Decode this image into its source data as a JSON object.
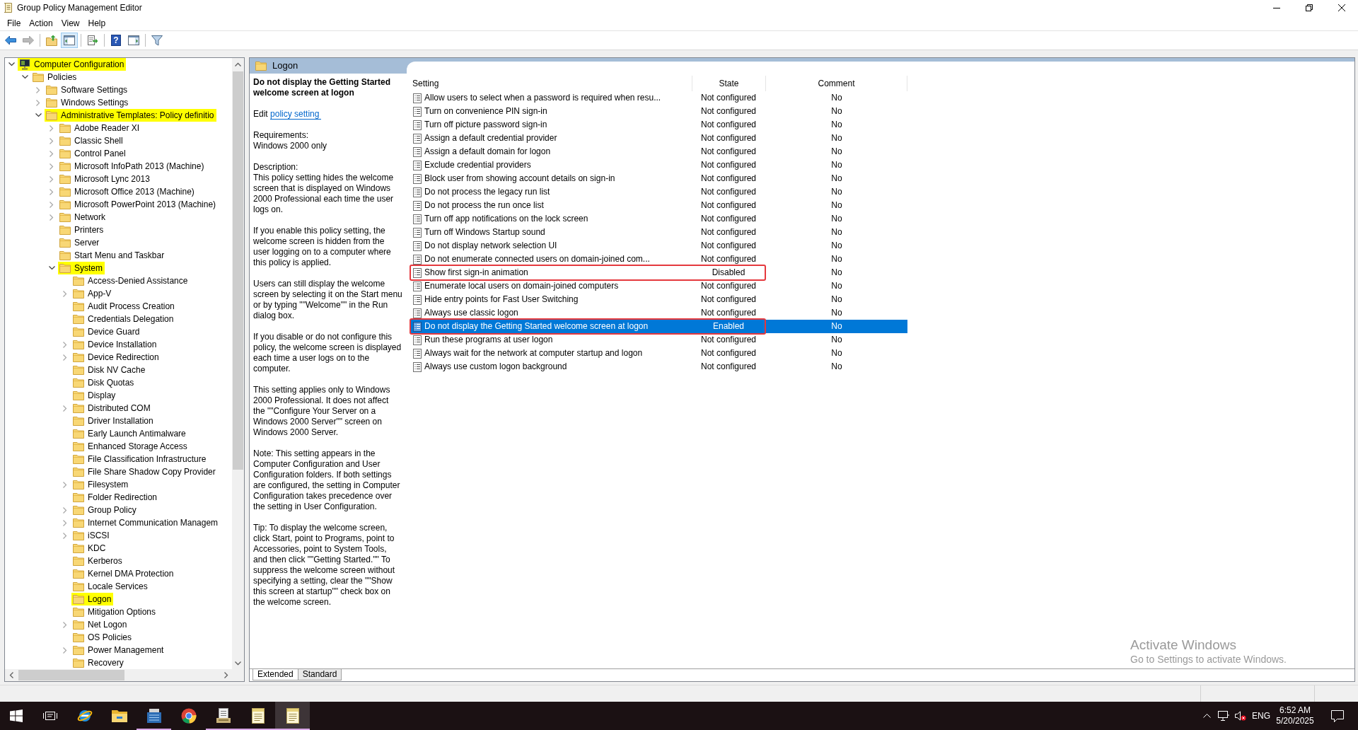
{
  "window": {
    "title": "Group Policy Management Editor"
  },
  "menu": [
    "File",
    "Action",
    "View",
    "Help"
  ],
  "toolbar": [
    {
      "kind": "back",
      "disabled": false,
      "pressed": false
    },
    {
      "kind": "forward",
      "disabled": true,
      "pressed": false
    },
    {
      "kind": "separator"
    },
    {
      "kind": "up",
      "disabled": false,
      "pressed": false
    },
    {
      "kind": "tree-pane",
      "disabled": false,
      "pressed": true
    },
    {
      "kind": "separator"
    },
    {
      "kind": "export",
      "disabled": false,
      "pressed": false
    },
    {
      "kind": "separator"
    },
    {
      "kind": "help",
      "glyph": "?",
      "disabled": false,
      "pressed": false
    },
    {
      "kind": "action-pane",
      "disabled": false,
      "pressed": false
    },
    {
      "kind": "separator"
    },
    {
      "kind": "filter",
      "disabled": false,
      "pressed": false
    }
  ],
  "tree": {
    "items": [
      {
        "label": "Computer Configuration",
        "kind": "computer",
        "expandable": true,
        "expanded": true,
        "highlighted": true,
        "children": [
          {
            "label": "Policies",
            "kind": "folder",
            "expandable": true,
            "expanded": true,
            "highlighted": false,
            "children": [
              {
                "label": "Software Settings",
                "kind": "folder",
                "expandable": true,
                "expanded": false,
                "highlighted": false
              },
              {
                "label": "Windows Settings",
                "kind": "folder",
                "expandable": true,
                "expanded": false,
                "highlighted": false
              },
              {
                "label": "Administrative Templates: Policy definitio",
                "kind": "folder",
                "expandable": true,
                "expanded": true,
                "highlighted": true,
                "children": [
                  {
                    "label": "Adobe Reader XI",
                    "kind": "folder",
                    "expandable": true,
                    "expanded": false,
                    "highlighted": false
                  },
                  {
                    "label": "Classic Shell",
                    "kind": "folder",
                    "expandable": true,
                    "expanded": false,
                    "highlighted": false
                  },
                  {
                    "label": "Control Panel",
                    "kind": "folder",
                    "expandable": true,
                    "expanded": false,
                    "highlighted": false
                  },
                  {
                    "label": "Microsoft InfoPath 2013 (Machine)",
                    "kind": "folder",
                    "expandable": true,
                    "expanded": false,
                    "highlighted": false
                  },
                  {
                    "label": "Microsoft Lync 2013",
                    "kind": "folder",
                    "expandable": true,
                    "expanded": false,
                    "highlighted": false
                  },
                  {
                    "label": "Microsoft Office 2013 (Machine)",
                    "kind": "folder",
                    "expandable": true,
                    "expanded": false,
                    "highlighted": false
                  },
                  {
                    "label": "Microsoft PowerPoint 2013 (Machine)",
                    "kind": "folder",
                    "expandable": true,
                    "expanded": false,
                    "highlighted": false
                  },
                  {
                    "label": "Network",
                    "kind": "folder",
                    "expandable": true,
                    "expanded": false,
                    "highlighted": false
                  },
                  {
                    "label": "Printers",
                    "kind": "folder",
                    "expandable": false,
                    "highlighted": false
                  },
                  {
                    "label": "Server",
                    "kind": "folder",
                    "expandable": false,
                    "highlighted": false
                  },
                  {
                    "label": "Start Menu and Taskbar",
                    "kind": "folder",
                    "expandable": false,
                    "highlighted": false
                  },
                  {
                    "label": "System",
                    "kind": "folder",
                    "expandable": true,
                    "expanded": true,
                    "highlighted": true,
                    "children": [
                      {
                        "label": "Access-Denied Assistance",
                        "kind": "folder",
                        "expandable": false,
                        "highlighted": false
                      },
                      {
                        "label": "App-V",
                        "kind": "folder",
                        "expandable": true,
                        "expanded": false,
                        "highlighted": false
                      },
                      {
                        "label": "Audit Process Creation",
                        "kind": "folder",
                        "expandable": false,
                        "highlighted": false
                      },
                      {
                        "label": "Credentials Delegation",
                        "kind": "folder",
                        "expandable": false,
                        "highlighted": false
                      },
                      {
                        "label": "Device Guard",
                        "kind": "folder",
                        "expandable": false,
                        "highlighted": false
                      },
                      {
                        "label": "Device Installation",
                        "kind": "folder",
                        "expandable": true,
                        "expanded": false,
                        "highlighted": false
                      },
                      {
                        "label": "Device Redirection",
                        "kind": "folder",
                        "expandable": true,
                        "expanded": false,
                        "highlighted": false
                      },
                      {
                        "label": "Disk NV Cache",
                        "kind": "folder",
                        "expandable": false,
                        "highlighted": false
                      },
                      {
                        "label": "Disk Quotas",
                        "kind": "folder",
                        "expandable": false,
                        "highlighted": false
                      },
                      {
                        "label": "Display",
                        "kind": "folder",
                        "expandable": false,
                        "highlighted": false
                      },
                      {
                        "label": "Distributed COM",
                        "kind": "folder",
                        "expandable": true,
                        "expanded": false,
                        "highlighted": false
                      },
                      {
                        "label": "Driver Installation",
                        "kind": "folder",
                        "expandable": false,
                        "highlighted": false
                      },
                      {
                        "label": "Early Launch Antimalware",
                        "kind": "folder",
                        "expandable": false,
                        "highlighted": false
                      },
                      {
                        "label": "Enhanced Storage Access",
                        "kind": "folder",
                        "expandable": false,
                        "highlighted": false
                      },
                      {
                        "label": "File Classification Infrastructure",
                        "kind": "folder",
                        "expandable": false,
                        "highlighted": false
                      },
                      {
                        "label": "File Share Shadow Copy Provider",
                        "kind": "folder",
                        "expandable": false,
                        "highlighted": false
                      },
                      {
                        "label": "Filesystem",
                        "kind": "folder",
                        "expandable": true,
                        "expanded": false,
                        "highlighted": false
                      },
                      {
                        "label": "Folder Redirection",
                        "kind": "folder",
                        "expandable": false,
                        "highlighted": false
                      },
                      {
                        "label": "Group Policy",
                        "kind": "folder",
                        "expandable": true,
                        "expanded": false,
                        "highlighted": false
                      },
                      {
                        "label": "Internet Communication Managem",
                        "kind": "folder",
                        "expandable": true,
                        "expanded": false,
                        "highlighted": false
                      },
                      {
                        "label": "iSCSI",
                        "kind": "folder",
                        "expandable": true,
                        "expanded": false,
                        "highlighted": false
                      },
                      {
                        "label": "KDC",
                        "kind": "folder",
                        "expandable": false,
                        "highlighted": false
                      },
                      {
                        "label": "Kerberos",
                        "kind": "folder",
                        "expandable": false,
                        "highlighted": false
                      },
                      {
                        "label": "Kernel DMA Protection",
                        "kind": "folder",
                        "expandable": false,
                        "highlighted": false
                      },
                      {
                        "label": "Locale Services",
                        "kind": "folder",
                        "expandable": false,
                        "highlighted": false
                      },
                      {
                        "label": "Logon",
                        "kind": "folder",
                        "expandable": false,
                        "highlighted": true
                      },
                      {
                        "label": "Mitigation Options",
                        "kind": "folder",
                        "expandable": false,
                        "highlighted": false
                      },
                      {
                        "label": "Net Logon",
                        "kind": "folder",
                        "expandable": true,
                        "expanded": false,
                        "highlighted": false
                      },
                      {
                        "label": "OS Policies",
                        "kind": "folder",
                        "expandable": false,
                        "highlighted": false
                      },
                      {
                        "label": "Power Management",
                        "kind": "folder",
                        "expandable": true,
                        "expanded": false,
                        "highlighted": false
                      },
                      {
                        "label": "Recovery",
                        "kind": "folder",
                        "expandable": false,
                        "highlighted": false
                      }
                    ]
                  }
                ]
              }
            ]
          }
        ]
      }
    ]
  },
  "details": {
    "heading": "Logon",
    "title": "Do not display the Getting Started welcome screen at logon",
    "edit_prefix": "Edit",
    "edit_link": "policy setting",
    "blocks": [
      {
        "label": "Requirements:",
        "text": "Windows 2000 only"
      },
      {
        "label": "Description:",
        "text": "This policy setting hides the welcome screen that is displayed on Windows 2000 Professional each time the user logs on."
      },
      {
        "text": "If you enable this policy setting, the welcome screen is hidden from the user logging on to a computer where this policy is applied."
      },
      {
        "text": "Users can still display the welcome screen by selecting it on the Start menu or by typing \"\"Welcome\"\" in the Run dialog box."
      },
      {
        "text": "If you disable or do not configure this policy, the welcome screen is displayed each time a user logs on to the computer."
      },
      {
        "text": "This setting applies only to Windows 2000 Professional. It does not affect the \"\"Configure Your Server on a Windows 2000 Server\"\" screen on Windows 2000 Server."
      },
      {
        "text": "Note: This setting appears in the Computer Configuration and User Configuration folders. If both settings are configured, the setting in Computer Configuration takes precedence over the setting in User Configuration."
      },
      {
        "text": "Tip: To display the welcome screen, click Start, point to Programs, point to Accessories, point to System Tools, and then click \"\"Getting Started.\"\" To suppress the welcome screen without specifying a setting, clear the \"\"Show this screen at startup\"\" check box on the welcome screen."
      }
    ]
  },
  "table": {
    "columns": [
      "Setting",
      "State",
      "Comment"
    ],
    "rows": [
      {
        "setting": "Allow users to select when a password is required when resu...",
        "state": "Not configured",
        "comment": "No",
        "selected": false,
        "outlined": false
      },
      {
        "setting": "Turn on convenience PIN sign-in",
        "state": "Not configured",
        "comment": "No",
        "selected": false,
        "outlined": false
      },
      {
        "setting": "Turn off picture password sign-in",
        "state": "Not configured",
        "comment": "No",
        "selected": false,
        "outlined": false
      },
      {
        "setting": "Assign a default credential provider",
        "state": "Not configured",
        "comment": "No",
        "selected": false,
        "outlined": false
      },
      {
        "setting": "Assign a default domain for logon",
        "state": "Not configured",
        "comment": "No",
        "selected": false,
        "outlined": false
      },
      {
        "setting": "Exclude credential providers",
        "state": "Not configured",
        "comment": "No",
        "selected": false,
        "outlined": false
      },
      {
        "setting": "Block user from showing account details on sign-in",
        "state": "Not configured",
        "comment": "No",
        "selected": false,
        "outlined": false
      },
      {
        "setting": "Do not process the legacy run list",
        "state": "Not configured",
        "comment": "No",
        "selected": false,
        "outlined": false
      },
      {
        "setting": "Do not process the run once list",
        "state": "Not configured",
        "comment": "No",
        "selected": false,
        "outlined": false
      },
      {
        "setting": "Turn off app notifications on the lock screen",
        "state": "Not configured",
        "comment": "No",
        "selected": false,
        "outlined": false
      },
      {
        "setting": "Turn off Windows Startup sound",
        "state": "Not configured",
        "comment": "No",
        "selected": false,
        "outlined": false
      },
      {
        "setting": "Do not display network selection UI",
        "state": "Not configured",
        "comment": "No",
        "selected": false,
        "outlined": false
      },
      {
        "setting": "Do not enumerate connected users on domain-joined com...",
        "state": "Not configured",
        "comment": "No",
        "selected": false,
        "outlined": false
      },
      {
        "setting": "Show first sign-in animation",
        "state": "Disabled",
        "comment": "No",
        "selected": false,
        "outlined": true
      },
      {
        "setting": "Enumerate local users on domain-joined computers",
        "state": "Not configured",
        "comment": "No",
        "selected": false,
        "outlined": false
      },
      {
        "setting": "Hide entry points for Fast User Switching",
        "state": "Not configured",
        "comment": "No",
        "selected": false,
        "outlined": false
      },
      {
        "setting": "Always use classic logon",
        "state": "Not configured",
        "comment": "No",
        "selected": false,
        "outlined": false
      },
      {
        "setting": "Do not display the Getting Started welcome screen at logon",
        "state": "Enabled",
        "comment": "No",
        "selected": true,
        "outlined": true
      },
      {
        "setting": "Run these programs at user logon",
        "state": "Not configured",
        "comment": "No",
        "selected": false,
        "outlined": false
      },
      {
        "setting": "Always wait for the network at computer startup and logon",
        "state": "Not configured",
        "comment": "No",
        "selected": false,
        "outlined": false
      },
      {
        "setting": "Always use custom logon background",
        "state": "Not configured",
        "comment": "No",
        "selected": false,
        "outlined": false
      }
    ]
  },
  "view_tabs": [
    {
      "label": "Extended",
      "selected": true
    },
    {
      "label": "Standard",
      "selected": false
    }
  ],
  "activation_notice": {
    "title": "Activate Windows",
    "text": "Go to Settings to activate Windows."
  },
  "taskbar": {
    "apps": [
      {
        "kind": "start"
      },
      {
        "kind": "task-view"
      },
      {
        "kind": "orbit-browser",
        "running": false,
        "active": false
      },
      {
        "kind": "folder",
        "running": false,
        "active": false
      },
      {
        "kind": "server",
        "running": true,
        "active": false
      },
      {
        "kind": "round-browser",
        "running": false,
        "active": false
      },
      {
        "kind": "document-stack",
        "running": true,
        "active": false
      },
      {
        "kind": "notepad",
        "running": true,
        "active": false
      },
      {
        "kind": "notepad",
        "running": true,
        "active": true
      }
    ],
    "tray": {
      "muted": true,
      "language": "ENG",
      "time": "6:52 AM",
      "date": "5/20/2025"
    }
  }
}
